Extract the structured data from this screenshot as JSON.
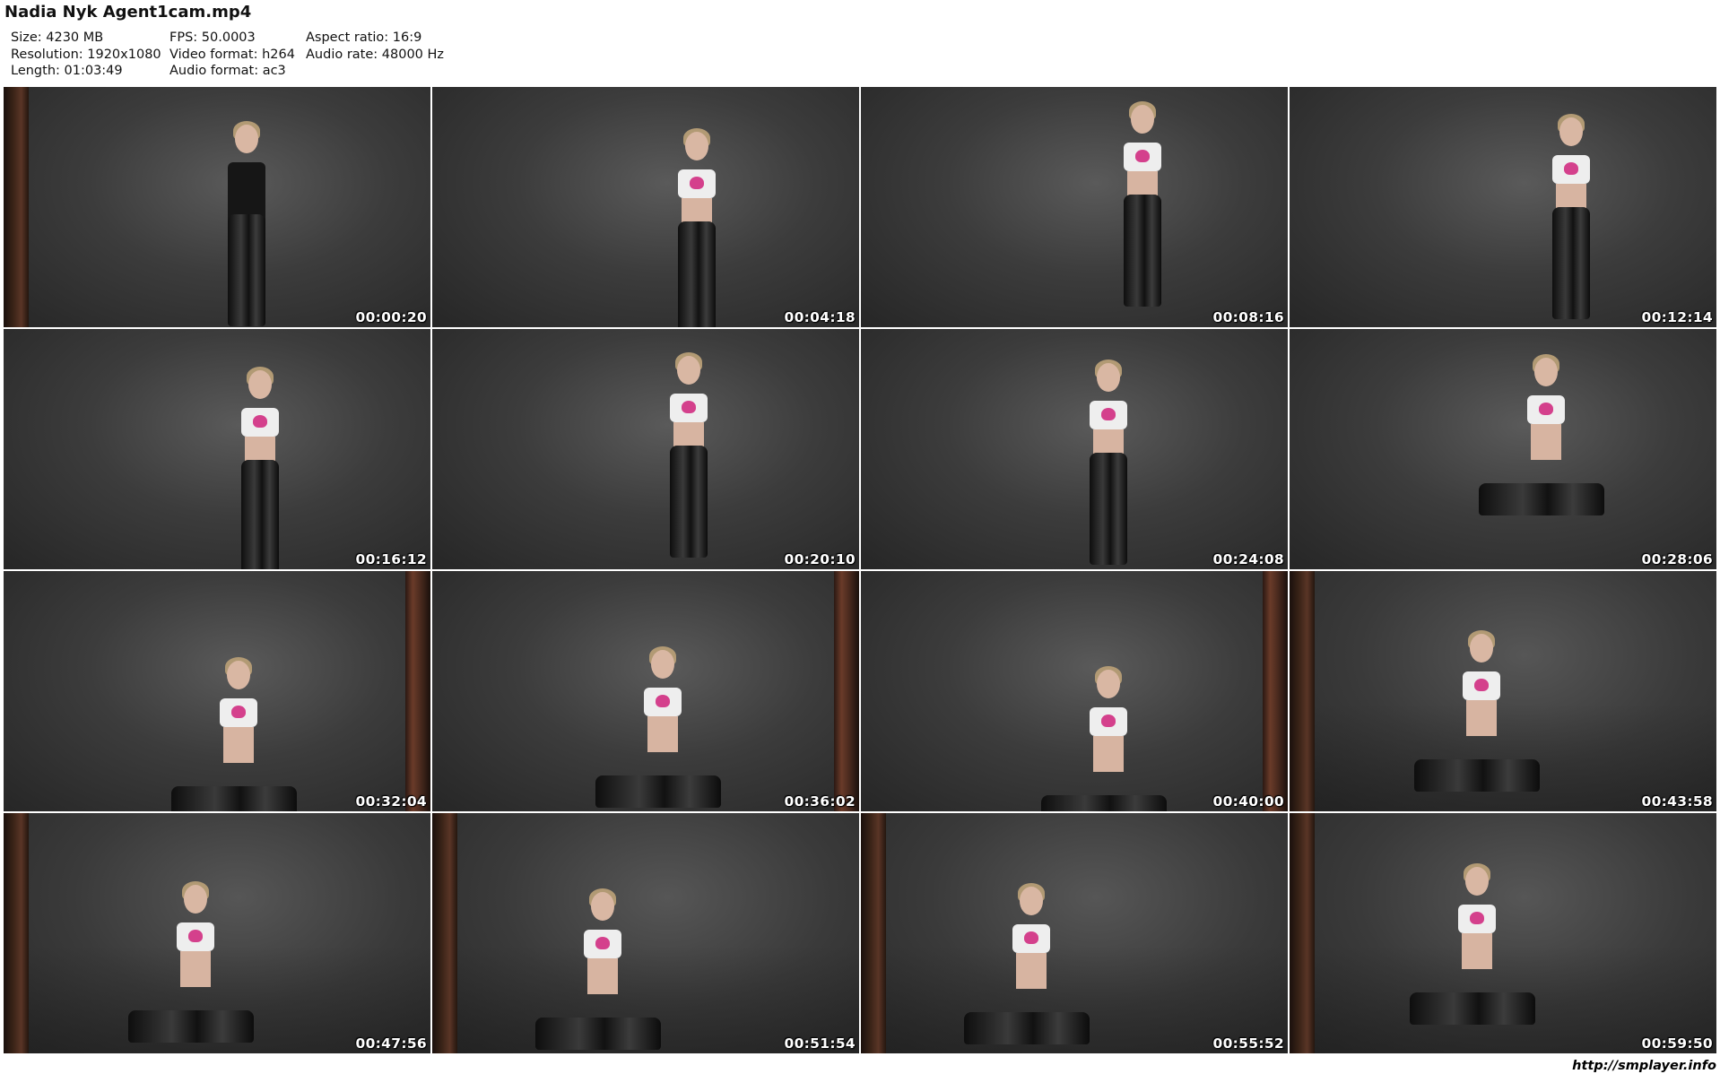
{
  "header": {
    "title": "Nadia Nyk Agent1cam.mp4",
    "col1": [
      "Size: 4230 MB",
      "Resolution: 1920x1080",
      "Length: 01:03:49"
    ],
    "col2": [
      "FPS: 50.0003",
      "Video format: h264",
      "Audio format: ac3"
    ],
    "col3": [
      "Aspect ratio: 16:9",
      "Audio rate: 48000 Hz"
    ]
  },
  "thumbnails": [
    {
      "timestamp": "00:00:20",
      "pose": "standing-coat",
      "backdrop": "stand-left"
    },
    {
      "timestamp": "00:04:18",
      "pose": "standing",
      "backdrop": "plain"
    },
    {
      "timestamp": "00:08:16",
      "pose": "standing",
      "backdrop": "plain"
    },
    {
      "timestamp": "00:12:14",
      "pose": "standing",
      "backdrop": "plain"
    },
    {
      "timestamp": "00:16:12",
      "pose": "standing",
      "backdrop": "plain"
    },
    {
      "timestamp": "00:20:10",
      "pose": "standing",
      "backdrop": "plain"
    },
    {
      "timestamp": "00:24:08",
      "pose": "standing",
      "backdrop": "plain"
    },
    {
      "timestamp": "00:28:06",
      "pose": "seated-chair",
      "backdrop": "plain"
    },
    {
      "timestamp": "00:32:04",
      "pose": "seated-chair",
      "backdrop": "stand-right"
    },
    {
      "timestamp": "00:36:02",
      "pose": "seated-chair",
      "backdrop": "stand-right"
    },
    {
      "timestamp": "00:40:00",
      "pose": "seated-chair",
      "backdrop": "stand-right"
    },
    {
      "timestamp": "00:43:58",
      "pose": "seated-floor",
      "backdrop": "stand-left"
    },
    {
      "timestamp": "00:47:56",
      "pose": "seated-floor",
      "backdrop": "stand-left"
    },
    {
      "timestamp": "00:51:54",
      "pose": "seated-floor",
      "backdrop": "stand-left"
    },
    {
      "timestamp": "00:55:52",
      "pose": "seated-floor",
      "backdrop": "stand-left"
    },
    {
      "timestamp": "00:59:50",
      "pose": "seated-floor",
      "backdrop": "stand-left"
    }
  ],
  "footer": {
    "url": "http://smplayer.info"
  }
}
